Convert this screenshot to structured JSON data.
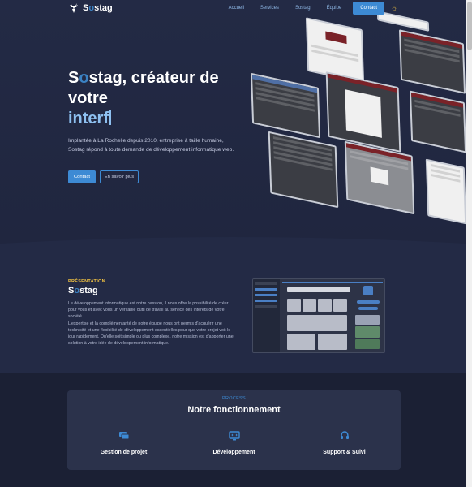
{
  "nav": {
    "brand_prefix": "S",
    "brand_o": "o",
    "brand_suffix": "stag",
    "links": [
      "Accueil",
      "Services",
      "Sostag",
      "Équipe"
    ],
    "contact_label": "Contact",
    "theme_icon": "sun-icon"
  },
  "hero": {
    "title_prefix": "S",
    "title_o": "o",
    "title_suffix": "stag, créateur de votre",
    "typed_text": "interf",
    "description": "Implantée à La Rochelle depuis 2010, entreprise à taille humaine, Sostag répond à toute demande de développement informatique web.",
    "primary_button": "Contact",
    "secondary_button": "En savoir plus"
  },
  "presentation": {
    "eyebrow": "PRÉSENTATION",
    "title_prefix": "S",
    "title_o": "o",
    "title_suffix": "stag",
    "text": "Le développement informatique est notre passion, il nous offre la possibilité de créer pour vous et avec vous un véritable outil de travail au service des intérêts de votre société.\nL'expertise et la complémentarité de notre équipe nous ont permis d'acquérir une technicité et une flexibilité de développement essentielles pour que votre projet voit le jour rapidement. Qu'elle soit simple ou plus complexe, notre mission est d'apporter une solution à votre idée de développement informatique."
  },
  "process": {
    "eyebrow": "PROCESS",
    "title": "Notre fonctionnement",
    "features": [
      {
        "label": "Gestion de projet",
        "icon": "chat-icon"
      },
      {
        "label": "Développement",
        "icon": "monitor-code-icon"
      },
      {
        "label": "Support & Suivi",
        "icon": "headset-icon"
      }
    ]
  },
  "colors": {
    "background": "#232a45",
    "accent": "#3d8ad4",
    "highlight": "#f5c542"
  }
}
